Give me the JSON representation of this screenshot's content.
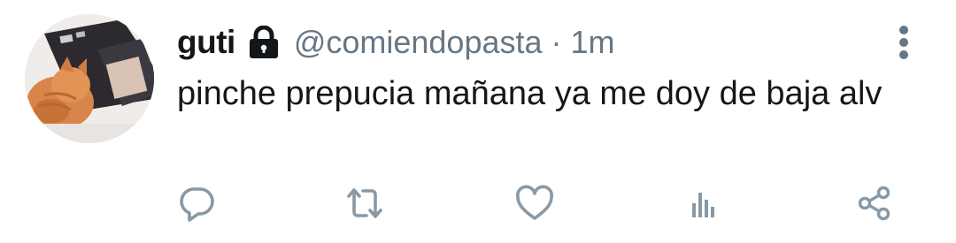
{
  "tweet": {
    "display_name": "guti",
    "handle": "@comiendopasta",
    "separator": "·",
    "time": "1m",
    "text": "pinche prepucia mañana ya me doy de baja alv"
  },
  "icons": {
    "lock": "lock-icon",
    "more": "more-vertical-icon",
    "reply": "reply-icon",
    "retweet": "retweet-icon",
    "like": "heart-icon",
    "analytics": "analytics-icon",
    "share": "share-icon"
  },
  "colors": {
    "text": "#14171a",
    "secondary": "#657786",
    "icon": "#8899a6",
    "background": "#ffffff"
  }
}
